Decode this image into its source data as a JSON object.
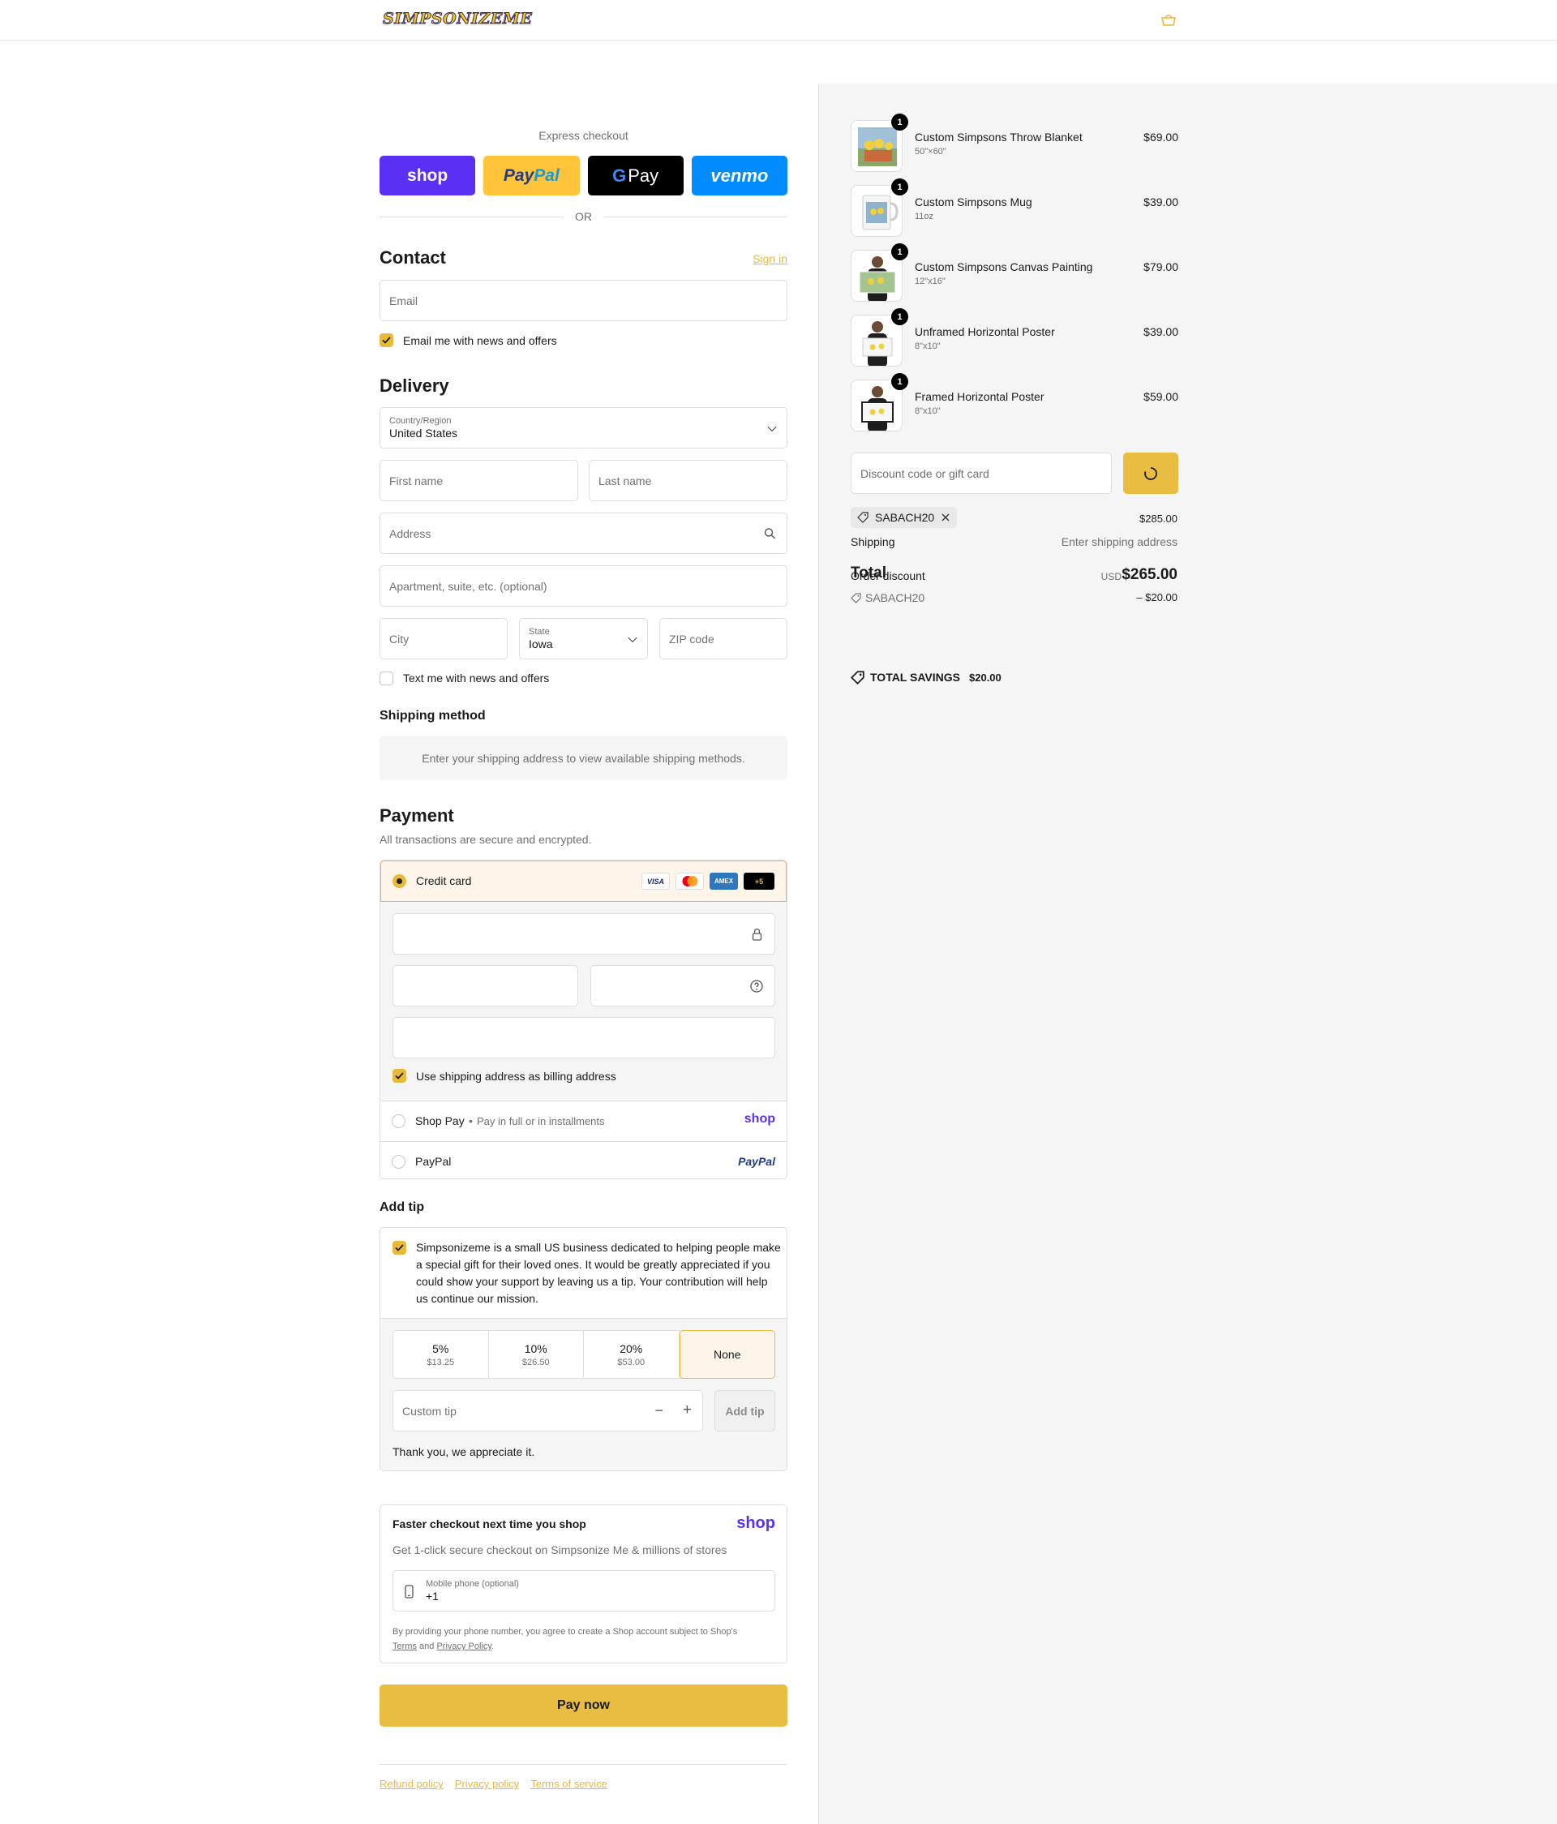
{
  "header": {
    "logo_text": "SIMPSONIZEME"
  },
  "express": {
    "title": "Express checkout",
    "buttons": {
      "shop": "shop",
      "paypal_a": "Pay",
      "paypal_b": "Pal",
      "gpay_g": "G",
      "gpay_text": "Pay",
      "venmo": "venmo"
    },
    "or": "OR"
  },
  "contact": {
    "title": "Contact",
    "signin": "Sign in",
    "email_placeholder": "Email",
    "news_label": "Email me with news and offers",
    "news_checked": true
  },
  "delivery": {
    "title": "Delivery",
    "country_label": "Country/Region",
    "country_value": "United States",
    "first_name": "First name",
    "last_name": "Last name",
    "address": "Address",
    "apartment": "Apartment, suite, etc. (optional)",
    "city": "City",
    "state_label": "State",
    "state_value": "Iowa",
    "zip": "ZIP code",
    "text_label": "Text me with news and offers",
    "text_checked": false
  },
  "shipping_method": {
    "title": "Shipping method",
    "message": "Enter your shipping address to view available shipping methods."
  },
  "payment": {
    "title": "Payment",
    "subtitle": "All transactions are secure and encrypted.",
    "credit_card": "Credit card",
    "card_logos": {
      "visa": "VISA",
      "amex": "AMEX",
      "more": "+5"
    },
    "billing_label": "Use shipping address as billing address",
    "billing_checked": true,
    "shop_pay": "Shop Pay",
    "shop_pay_sub": "Pay in full or in installments",
    "shop_logo": "shop",
    "paypal": "PayPal",
    "paypal_logo": "PayPal"
  },
  "tip": {
    "title": "Add tip",
    "message": "Simpsonizeme is a small US business dedicated to helping people make a special gift for their loved ones. It would be greatly appreciated if you could show your support by leaving us a tip. Your contribution will help us continue our mission.",
    "options": [
      {
        "pct": "5%",
        "amt": "$13.25"
      },
      {
        "pct": "10%",
        "amt": "$26.50"
      },
      {
        "pct": "20%",
        "amt": "$53.00"
      },
      {
        "pct": "None",
        "amt": ""
      }
    ],
    "custom_placeholder": "Custom tip",
    "add_label": "Add tip",
    "thanks": "Thank you, we appreciate it."
  },
  "shop_signup": {
    "title": "Faster checkout next time you shop",
    "logo": "shop",
    "subtitle": "Get 1-click secure checkout on Simpsonize Me & millions of stores",
    "phone_label": "Mobile phone (optional)",
    "phone_value": "+1",
    "legal_pre": "By providing your phone number, you agree to create a Shop account subject to Shop's",
    "terms": "Terms",
    "and": "and",
    "privacy": "Privacy Policy",
    "period": "."
  },
  "pay_now": "Pay now",
  "footer": {
    "refund": "Refund policy",
    "privacy": "Privacy policy",
    "terms": "Terms of service"
  },
  "cart": {
    "items": [
      {
        "name": "Custom Simpsons Throw Blanket",
        "variant": "50\"×60\"",
        "price": "$69.00",
        "qty": "1"
      },
      {
        "name": "Custom Simpsons Mug",
        "variant": "11oz",
        "price": "$39.00",
        "qty": "1"
      },
      {
        "name": "Custom Simpsons Canvas Painting",
        "variant": "12\"x16\"",
        "price": "$79.00",
        "qty": "1"
      },
      {
        "name": "Unframed Horizontal Poster",
        "variant": "8\"x10\"",
        "price": "$39.00",
        "qty": "1"
      },
      {
        "name": "Framed Horizontal Poster",
        "variant": "8\"x10\"",
        "price": "$59.00",
        "qty": "1"
      }
    ],
    "discount_placeholder": "Discount code or gift card",
    "applied_code": "SABACH20",
    "subtotal": "$285.00",
    "shipping_label": "Shipping",
    "shipping_value": "Enter shipping address",
    "total_label": "Total",
    "currency": "USD",
    "total": "$265.00",
    "order_discount_label": "Order discount",
    "order_discount_code": "SABACH20",
    "order_discount_value": "– $20.00",
    "savings_label": "TOTAL SAVINGS",
    "savings_value": "$20.00"
  },
  "colors": {
    "accent": "#e9b93a",
    "shop_purple": "#5a31f4",
    "paypal_yellow": "#ffc439",
    "venmo_blue": "#008cff",
    "sidebar_bg": "#f5f5f5"
  }
}
